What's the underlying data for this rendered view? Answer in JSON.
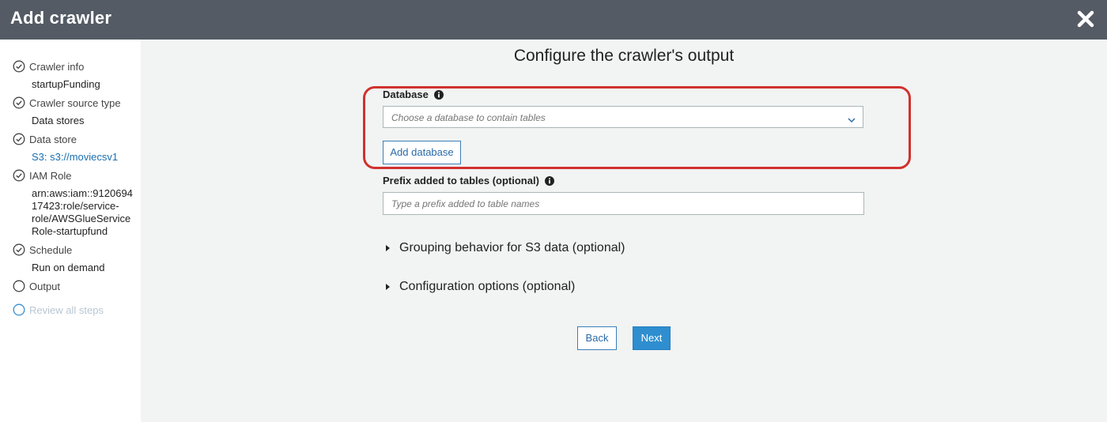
{
  "header": {
    "title": "Add crawler",
    "close_icon": "close-icon"
  },
  "sidebar": {
    "steps": [
      {
        "label": "Crawler info",
        "value": "startupFunding",
        "status": "complete"
      },
      {
        "label": "Crawler source type",
        "value": "Data stores",
        "status": "complete"
      },
      {
        "label": "Data store",
        "value": "S3: s3://moviecsv1",
        "status": "complete"
      },
      {
        "label": "IAM Role",
        "value_lines": [
          "arn:aws:iam::9120694",
          "17423:role/service-",
          "role/AWSGlueService",
          "Role-startupfund"
        ],
        "status": "complete"
      },
      {
        "label": "Schedule",
        "value": "Run on demand",
        "status": "complete"
      },
      {
        "label": "Output",
        "status": "current"
      },
      {
        "label": "Review all steps",
        "status": "disabled"
      }
    ]
  },
  "main": {
    "title": "Configure the crawler's output",
    "database": {
      "label": "Database",
      "placeholder": "Choose a database to contain tables",
      "add_button": "Add database"
    },
    "prefix": {
      "label": "Prefix added to tables (optional)",
      "placeholder": "Type a prefix added to table names"
    },
    "sections": [
      {
        "label": "Grouping behavior for S3 data (optional)"
      },
      {
        "label": "Configuration options (optional)"
      }
    ],
    "back_button": "Back",
    "next_button": "Next"
  },
  "colors": {
    "header_bg": "#545b64",
    "main_bg": "#f2f3f3",
    "primary": "#2f8ecf",
    "highlight": "#d0312d",
    "link": "#1a6fb0"
  }
}
